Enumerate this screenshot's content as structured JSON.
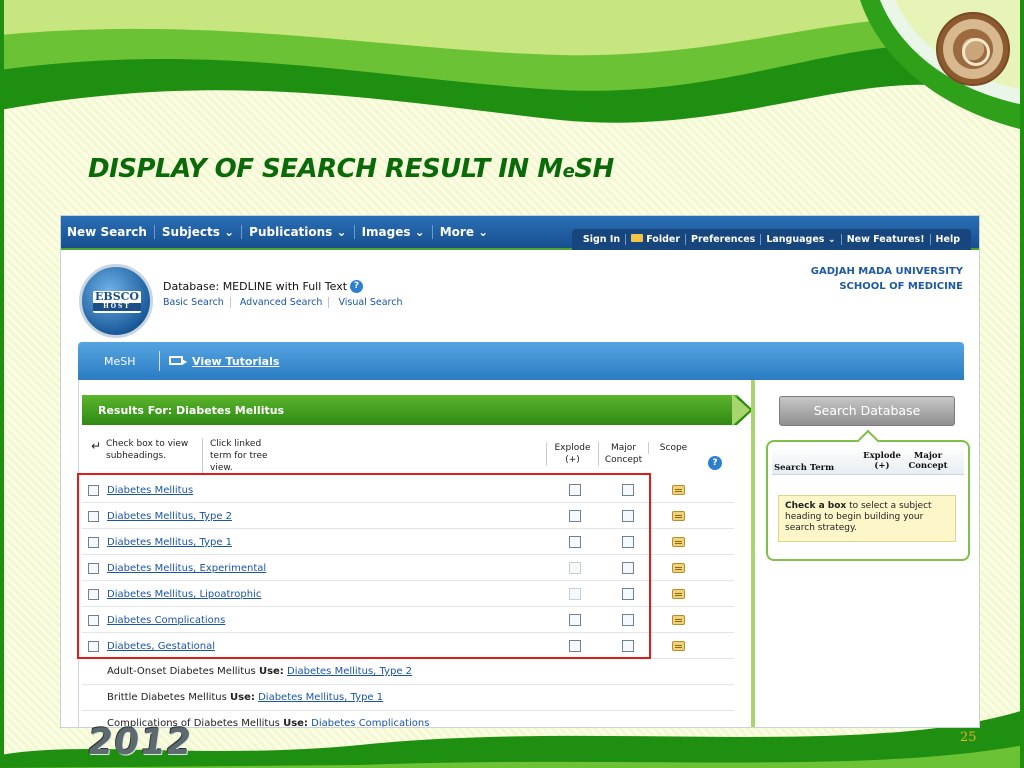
{
  "slide": {
    "title_main": "DISPLAY OF SEARCH RESULT IN ",
    "title_m": "M",
    "title_e": "e",
    "title_sh": "SH",
    "year": "2012",
    "page_number": "25"
  },
  "colors": {
    "brand_green": "#2f8a14",
    "nav_blue": "#184f8f",
    "link_blue": "#1a55a8",
    "highlight_red": "#e11a1a"
  },
  "topnav": {
    "menu": [
      "New Search",
      "Subjects ⌄",
      "Publications ⌄",
      "Images ⌄",
      "More ⌄"
    ],
    "right": [
      "Sign In",
      "Folder",
      "Preferences",
      "Languages ⌄",
      "New Features!",
      "Help"
    ]
  },
  "header": {
    "logo_top": "EBSCO",
    "logo_bottom": "HOST",
    "database_label": "Database: MEDLINE with Full Text",
    "links": [
      "Basic Search",
      "Advanced Search",
      "Visual Search"
    ],
    "institution_line1": "GADJAH MADA UNIVERSITY",
    "institution_line2": "SCHOOL OF MEDICINE"
  },
  "mesh_bar": {
    "label": "MeSH",
    "tutorials": "View Tutorials"
  },
  "results": {
    "title": "Results For: Diabetes Mellitus",
    "hint_checkbox": "Check box to view subheadings.",
    "hint_tree": "Click linked term for tree view.",
    "col_explode": "Explode (+)",
    "col_major": "Major Concept",
    "col_scope": "Scope",
    "terms": [
      {
        "label": "Diabetes Mellitus"
      },
      {
        "label": "Diabetes Mellitus, Type 2"
      },
      {
        "label": "Diabetes Mellitus, Type 1"
      },
      {
        "label": "Diabetes Mellitus, Experimental"
      },
      {
        "label": "Diabetes Mellitus, Lipoatrophic"
      },
      {
        "label": "Diabetes Complications"
      },
      {
        "label": "Diabetes, Gestational"
      }
    ],
    "use_rows": [
      {
        "term": "Adult-Onset Diabetes Mellitus",
        "use": "Use:",
        "link": "Diabetes Mellitus, Type 2"
      },
      {
        "term": "Brittle Diabetes Mellitus",
        "use": "Use:",
        "link": "Diabetes Mellitus, Type 1"
      },
      {
        "term": "Complications of Diabetes Mellitus",
        "use": "Use:",
        "link": "Diabetes Complications"
      }
    ]
  },
  "side_panel": {
    "search_button": "Search Database",
    "col_term": "Search Term",
    "col_explode": "Explode (+)",
    "col_major": "Major Concept",
    "note_bold": "Check a box",
    "note_rest": " to select a subject heading to begin building your search strategy."
  }
}
